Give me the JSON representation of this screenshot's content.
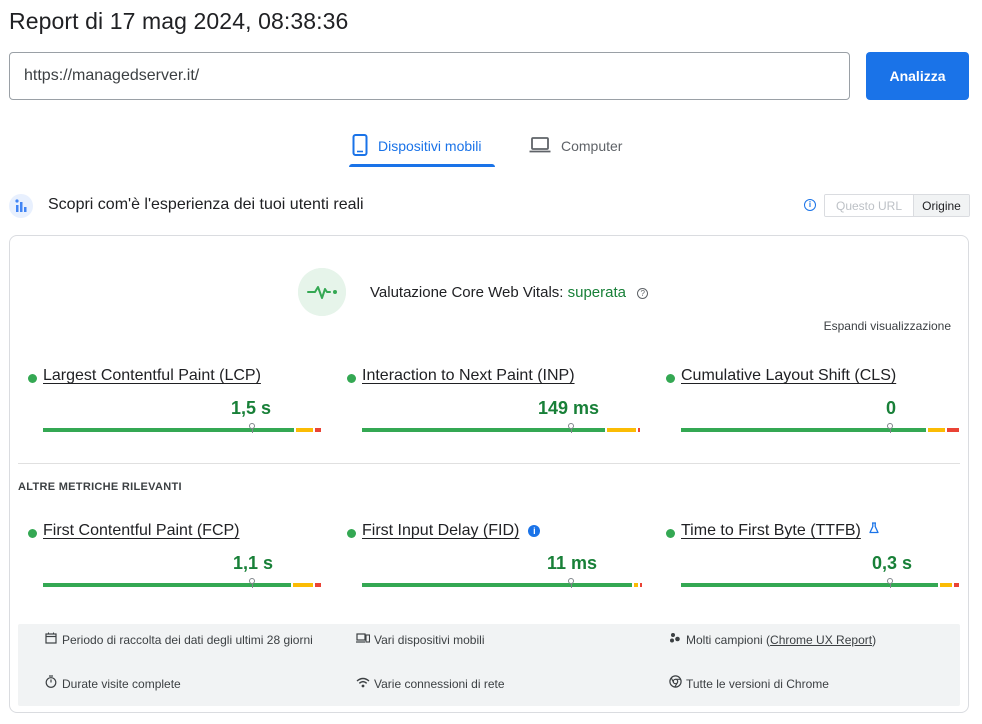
{
  "report": {
    "title": "Report di 17 mag 2024, 08:38:36"
  },
  "search": {
    "url_value": "https://managedserver.it/",
    "analyze_label": "Analizza"
  },
  "tabs": {
    "mobile_label": "Dispositivi mobili",
    "desktop_label": "Computer",
    "active": "mobile"
  },
  "field_data": {
    "title": "Scopri com'è l'esperienza dei tuoi utenti reali",
    "toggle": {
      "url_label": "Questo URL",
      "origin_label": "Origine",
      "selected": "Origine"
    }
  },
  "cwv": {
    "assessment_label": "Valutazione Core Web Vitals:",
    "assessment_status": "superata",
    "expand_label": "Espandi visualizzazione"
  },
  "core_metrics": [
    {
      "name": "Largest Contentful Paint (LCP)",
      "value": "1,5 s",
      "status": "good",
      "distribution": [
        0.91,
        0.07,
        0.02
      ],
      "marker": 0.75
    },
    {
      "name": "Interaction to Next Paint (INP)",
      "value": "149 ms",
      "status": "good",
      "distribution": [
        0.88,
        0.11,
        0.01
      ],
      "marker": 0.75
    },
    {
      "name": "Cumulative Layout Shift (CLS)",
      "value": "0",
      "status": "good",
      "distribution": [
        0.89,
        0.07,
        0.04
      ],
      "marker": 0.75
    }
  ],
  "other_metrics_label": "ALTRE METRICHE RILEVANTI",
  "other_metrics": [
    {
      "name": "First Contentful Paint (FCP)",
      "value": "1,1 s",
      "status": "good",
      "distribution": [
        0.9,
        0.08,
        0.02
      ],
      "marker": 0.75,
      "badge": "info"
    },
    {
      "name": "First Input Delay (FID)",
      "value": "11 ms",
      "status": "good",
      "distribution": [
        0.98,
        0.02,
        0.0
      ],
      "marker": 0.75,
      "badge": "info-filled"
    },
    {
      "name": "Time to First Byte (TTFB)",
      "value": "0,3 s",
      "status": "good",
      "distribution": [
        0.93,
        0.05,
        0.02
      ],
      "marker": 0.75,
      "badge": "flask"
    }
  ],
  "footer": {
    "period": "Periodo di raccolta dei dati degli ultimi 28 giorni",
    "visits": "Durate visite complete",
    "devices": "Vari dispositivi mobili",
    "network": "Varie connessioni di rete",
    "samples_prefix": "Molti campioni (",
    "samples_link": "Chrome UX Report",
    "samples_suffix": ")",
    "chrome": "Tutte le versioni di Chrome"
  },
  "colors": {
    "accent": "#1a73e8",
    "good": "#34a853",
    "good_text": "#188038",
    "average": "#fbbc04",
    "poor": "#ea4335"
  },
  "icons": [
    "smartphone-icon",
    "laptop-icon",
    "users-icon",
    "info-icon",
    "pulse-icon",
    "help-icon",
    "calendar-icon",
    "devices-icon",
    "samples-icon",
    "timer-icon",
    "wifi-icon",
    "chrome-icon",
    "flask-icon"
  ]
}
